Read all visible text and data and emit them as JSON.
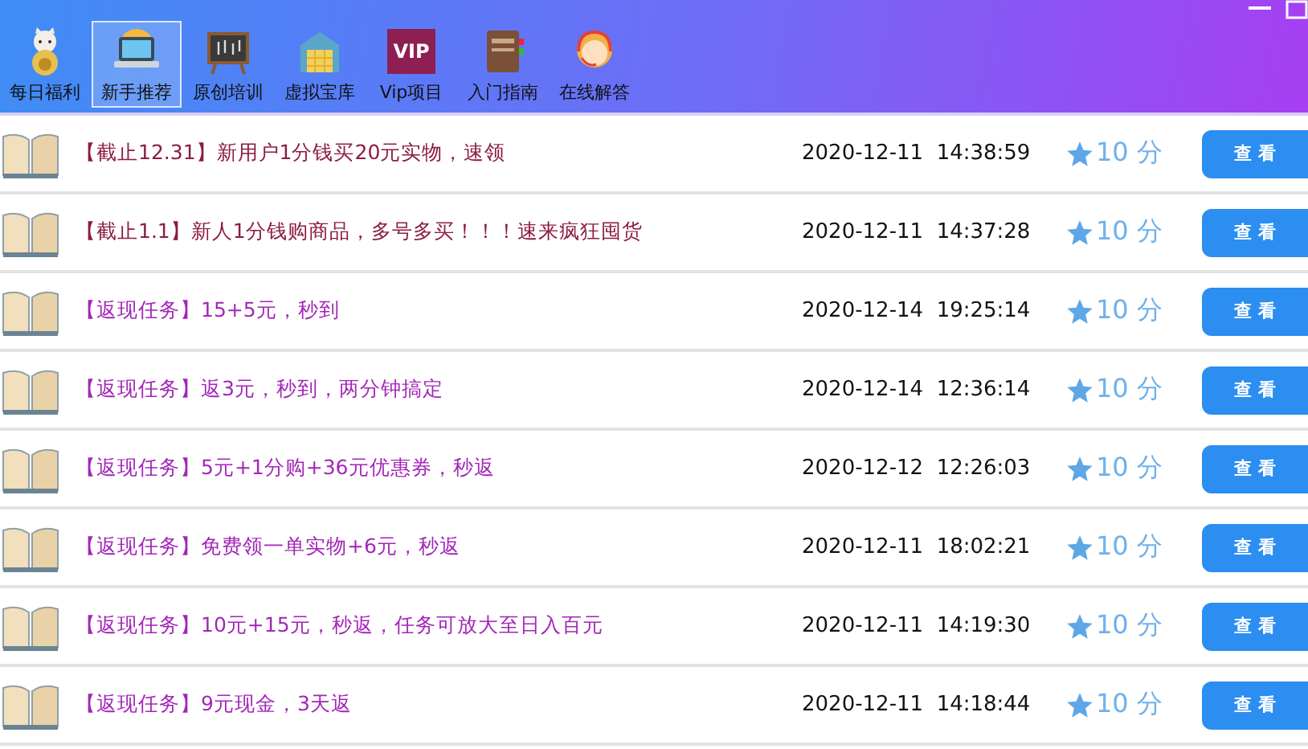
{
  "toolbar": [
    {
      "label": "每日福利",
      "kind": "cat",
      "selected": false
    },
    {
      "label": "新手推荐",
      "kind": "laptop",
      "selected": true
    },
    {
      "label": "原创培训",
      "kind": "board",
      "selected": false
    },
    {
      "label": "虚拟宝库",
      "kind": "vault",
      "selected": false
    },
    {
      "label": "Vip项目",
      "kind": "vip",
      "selected": false,
      "icon_text": "VIP"
    },
    {
      "label": "入门指南",
      "kind": "guide",
      "selected": false
    },
    {
      "label": "在线解答",
      "kind": "support",
      "selected": false
    }
  ],
  "rows": [
    {
      "title": "【截止12.31】新用户1分钱买20元实物，速领",
      "color": "#8b1d3f",
      "time": "2020-12-11  14:38:59",
      "score": "10 分",
      "button": "查看"
    },
    {
      "title": "【截止1.1】新人1分钱购商品，多号多买！！！速来疯狂囤货",
      "color": "#8b1d3f",
      "time": "2020-12-11  14:37:28",
      "score": "10 分",
      "button": "查看"
    },
    {
      "title": "【返现任务】15+5元，秒到",
      "color": "#a326b8",
      "time": "2020-12-14  19:25:14",
      "score": "10 分",
      "button": "查看"
    },
    {
      "title": "【返现任务】返3元，秒到，两分钟搞定",
      "color": "#a326b8",
      "time": "2020-12-14  12:36:14",
      "score": "10 分",
      "button": "查看"
    },
    {
      "title": "【返现任务】5元+1分购+36元优惠券，秒返",
      "color": "#a326b8",
      "time": "2020-12-12  12:26:03",
      "score": "10 分",
      "button": "查看"
    },
    {
      "title": "【返现任务】免费领一单实物+6元，秒返",
      "color": "#a326b8",
      "time": "2020-12-11  18:02:21",
      "score": "10 分",
      "button": "查看"
    },
    {
      "title": "【返现任务】10元+15元，秒返，任务可放大至日入百元",
      "color": "#a326b8",
      "time": "2020-12-11  14:19:30",
      "score": "10 分",
      "button": "查看"
    },
    {
      "title": "【返现任务】9元现金，3天返",
      "color": "#a326b8",
      "time": "2020-12-11  14:18:44",
      "score": "10 分",
      "button": "查看"
    }
  ]
}
